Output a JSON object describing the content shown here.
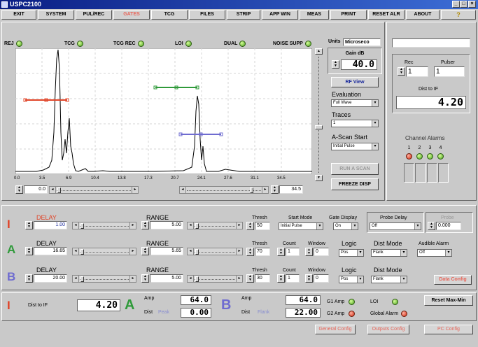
{
  "window": {
    "title": "USPC2100",
    "min": "_",
    "max": "□",
    "close": "×"
  },
  "menu": [
    "EXIT",
    "SYSTEM",
    "PUL/REC",
    "GATES",
    "TCG",
    "FILES",
    "STRIP",
    "APP WIN",
    "MEAS",
    "PRINT",
    "RESET ALR",
    "ABOUT",
    "?"
  ],
  "ascan_bar": {
    "rej": "REJ",
    "tcg": "TCG",
    "tcg_rec": "TCG REC",
    "loi": "LOI",
    "dual": "DUAL",
    "noise_supp": "NOISE SUPP"
  },
  "xaxis": [
    "0.0",
    "3.5",
    "6.9",
    "10.4",
    "13.8",
    "17.3",
    "20.7",
    "24.1",
    "27.6",
    "31.1",
    "34.5"
  ],
  "range": {
    "start": "0.0",
    "end": "34.5"
  },
  "side": {
    "units_label": "Units",
    "units_value": "Microseco",
    "gain_label": "Gain dB",
    "gain_value": "40.0",
    "rf_view": "RF View",
    "evaluation_label": "Evaluation",
    "evaluation_value": "Full Wave",
    "traces_label": "Traces",
    "traces_value": "1",
    "ascan_start_label": "A-Scan Start",
    "ascan_start_value": "Initial Pulse",
    "run_ascan": "RUN A SCAN",
    "freeze": "FREEZE DISP"
  },
  "right": {
    "rec_label": "Rec",
    "pulser_label": "Pulser",
    "rec_value": "1",
    "pulser_value": "1",
    "dist_label": "Dist to IF",
    "dist_value": "4.20",
    "alarms_label": "Channel Alarms",
    "alarm_nums": [
      "1",
      "2",
      "3",
      "4"
    ]
  },
  "gate_i": {
    "letter": "I",
    "delay_label": "DELAY",
    "delay_value": "1.00",
    "range_label": "RANGE",
    "range_value": "5.00",
    "thresh_label": "Thresh",
    "thresh_value": "50",
    "start_mode_label": "Start Mode",
    "start_mode_value": "Initial Pulse",
    "gate_display_label": "Gate Display",
    "gate_display_value": "On",
    "probe_delay_label": "Probe Delay",
    "probe_delay_value": "Off",
    "probe_label": "Probe",
    "probe_value": "0.000"
  },
  "gate_a": {
    "letter": "A",
    "delay_label": "DELAY",
    "delay_value": "16.65",
    "range_label": "RANGE",
    "range_value": "5.65",
    "thresh_label": "Thresh",
    "thresh_value": "70",
    "count_label": "Count",
    "count_value": "1",
    "window_label": "Window",
    "window_value": "0",
    "logic_label": "Logic",
    "logic_value": "Pos",
    "dist_mode_label": "Dist Mode",
    "dist_mode_value": "Flank",
    "audible_label": "Audible Alarm",
    "audible_value": "Off"
  },
  "gate_b": {
    "letter": "B",
    "delay_label": "DELAY",
    "delay_value": "20.00",
    "range_label": "RANGE",
    "range_value": "5.00",
    "thresh_label": "Thresh",
    "thresh_value": "30",
    "count_label": "Count",
    "count_value": "1",
    "window_label": "Window",
    "window_value": "0",
    "logic_label": "Logic",
    "logic_value": "Pos",
    "dist_mode_label": "Dist Mode",
    "dist_mode_value": "Flank",
    "data_config": "Data Config"
  },
  "bottom": {
    "i_letter": "I",
    "dist_label": "Dist to IF",
    "dist_value": "4.20",
    "a_letter": "A",
    "a_amp_label": "Amp",
    "a_amp_value": "64.0",
    "a_dist_label": "Dist",
    "a_dist_sub": "Peak",
    "a_dist_value": "0.00",
    "b_letter": "B",
    "b_amp_label": "Amp",
    "b_amp_value": "64.0",
    "b_dist_label": "Dist",
    "b_dist_sub": "Flank",
    "b_dist_value": "22.00",
    "g1_amp": "G1 Amp",
    "g2_amp": "G2 Amp",
    "loi": "LOI",
    "global_alarm": "Global Alarm",
    "reset_maxmin": "Reset Max-Min",
    "general_config": "General Config",
    "outputs_config": "Outputs Config",
    "pc_config": "PC Config"
  },
  "colors": {
    "gate_i": "#e04428",
    "gate_a": "#2f9a3a",
    "gate_b": "#6f6cd0",
    "accent": "#e8665a",
    "title_from": "#0a1e84",
    "title_to": "#3d6ed6"
  }
}
